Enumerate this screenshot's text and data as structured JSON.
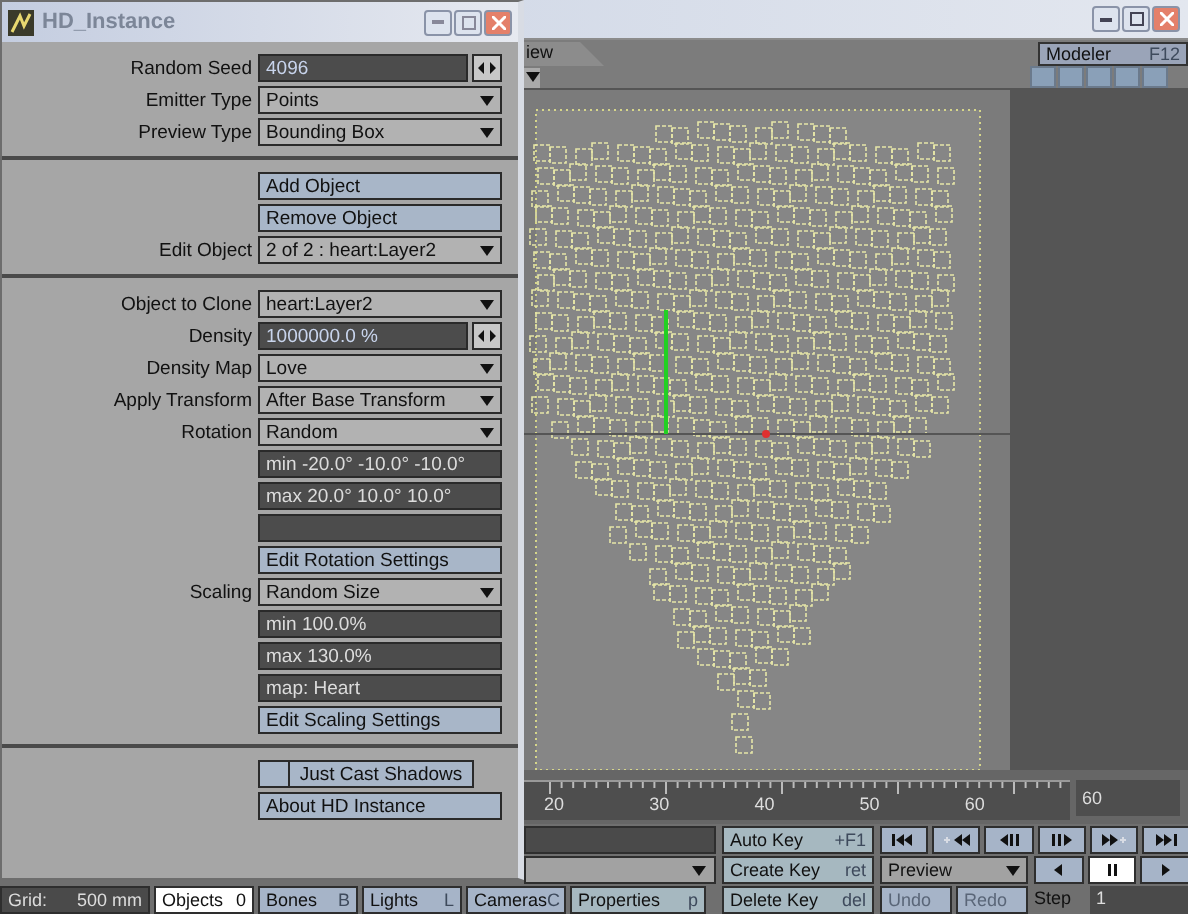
{
  "panel": {
    "title": "HD_Instance",
    "sections": [
      {
        "rows": [
          {
            "kind": "number",
            "label": "Random Seed",
            "value": "4096"
          },
          {
            "kind": "dropdown",
            "label": "Emitter Type",
            "value": "Points"
          },
          {
            "kind": "dropdown",
            "label": "Preview Type",
            "value": "Bounding Box"
          }
        ]
      },
      {
        "rows": [
          {
            "kind": "button",
            "text": "Add Object"
          },
          {
            "kind": "button",
            "text": "Remove Object"
          },
          {
            "kind": "dropdown",
            "label": "Edit Object",
            "value": "2 of 2 : heart:Layer2"
          }
        ]
      },
      {
        "rows": [
          {
            "kind": "dropdown",
            "label": "Object to Clone",
            "value": "heart:Layer2"
          },
          {
            "kind": "number",
            "label": "Density",
            "value": "1000000.0 %"
          },
          {
            "kind": "dropdown",
            "label": "Density Map",
            "value": "Love"
          },
          {
            "kind": "dropdown",
            "label": "Apply Transform",
            "value": "After Base Transform"
          },
          {
            "kind": "dropdown",
            "label": "Rotation",
            "value": "Random"
          },
          {
            "kind": "readout",
            "value": "min -20.0° -10.0° -10.0°"
          },
          {
            "kind": "readout",
            "value": "max 20.0° 10.0° 10.0°"
          },
          {
            "kind": "readout"
          },
          {
            "kind": "button",
            "text": "Edit Rotation Settings"
          },
          {
            "kind": "dropdown",
            "label": "Scaling",
            "value": "Random Size"
          },
          {
            "kind": "readout",
            "value": "min 100.0%"
          },
          {
            "kind": "readout",
            "value": "max 130.0%"
          },
          {
            "kind": "readout",
            "value": "map: Heart"
          },
          {
            "kind": "button",
            "text": "Edit Scaling Settings"
          }
        ]
      },
      {
        "rows": [
          {
            "kind": "toggle",
            "text": "Just Cast Shadows",
            "checked": false
          },
          {
            "kind": "button",
            "text": "About HD Instance"
          }
        ]
      }
    ]
  },
  "viewport_tab": "iew",
  "modeler_button": {
    "label": "Modeler",
    "shortcut": "F12"
  },
  "timeline": {
    "ticks": [
      "20",
      "30",
      "40",
      "50",
      "60"
    ],
    "frame": "60"
  },
  "key_buttons": [
    {
      "label": "Auto Key",
      "shortcut": "+F1"
    },
    {
      "label": "Create Key",
      "shortcut": "ret"
    },
    {
      "label": "Delete Key",
      "shortcut": "del"
    }
  ],
  "transport": [
    {
      "kind": "first"
    },
    {
      "kind": "prev-key"
    },
    {
      "kind": "step-back"
    },
    {
      "kind": "step-forward"
    },
    {
      "kind": "next-key"
    },
    {
      "kind": "last"
    }
  ],
  "play_buttons": [
    {
      "kind": "reverse",
      "selected": false
    },
    {
      "kind": "pause",
      "selected": true
    },
    {
      "kind": "play",
      "selected": false
    }
  ],
  "preview": "Preview",
  "history": [
    {
      "label": "Undo",
      "disabled": true
    },
    {
      "label": "Redo",
      "disabled": true
    }
  ],
  "step": {
    "label": "Step",
    "value": "1"
  },
  "status_bar": [
    {
      "kind": "readout",
      "label": "Grid:",
      "value": "500 mm"
    },
    {
      "kind": "tab",
      "label": "Objects",
      "shortcut": "0",
      "selected": true
    },
    {
      "kind": "tab",
      "label": "Bones",
      "shortcut": "B",
      "selected": false
    },
    {
      "kind": "tab",
      "label": "Lights",
      "shortcut": "L",
      "selected": false
    },
    {
      "kind": "tab",
      "label": "Cameras",
      "shortcut": "C",
      "selected": false
    },
    {
      "kind": "button",
      "label": "Properties",
      "shortcut": "p"
    }
  ]
}
